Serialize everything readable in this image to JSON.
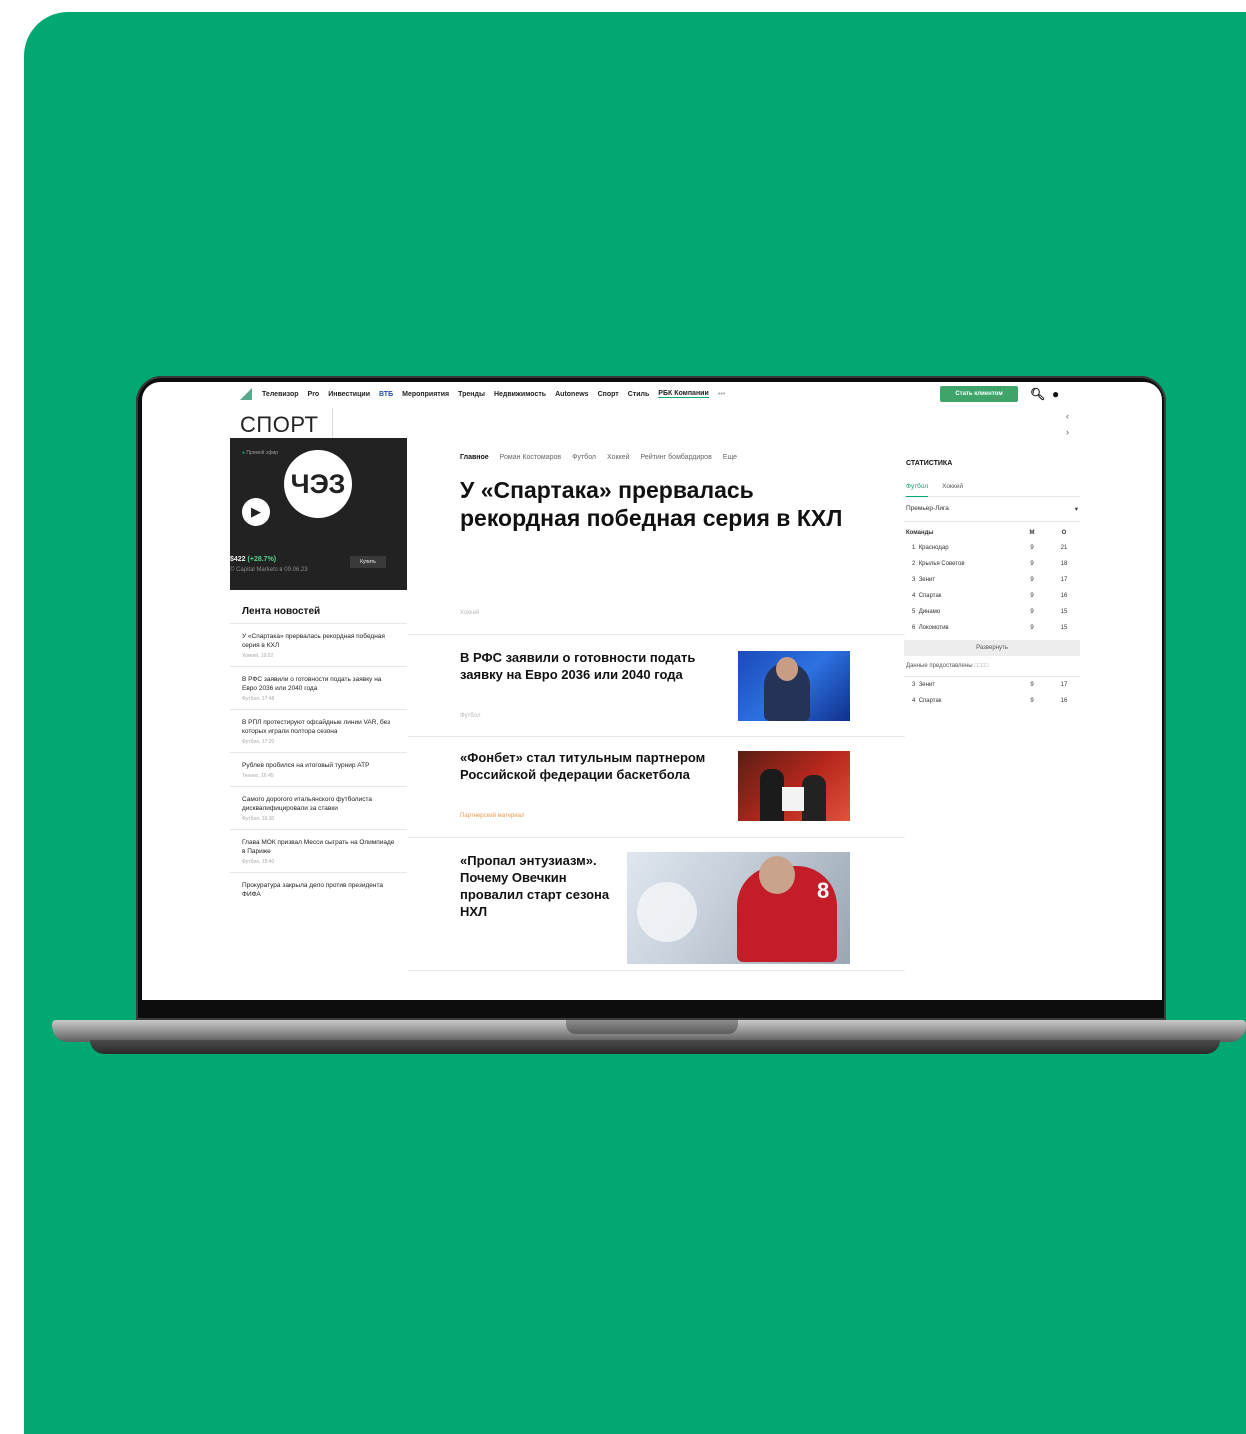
{
  "topnav": {
    "items": [
      "Телевизор",
      "Pro",
      "Инвестиции",
      "ВТБ",
      "Мероприятия",
      "Тренды",
      "Недвижимость",
      "Autonews",
      "Спорт",
      "Стиль",
      "РБК Компании",
      "•••"
    ],
    "cta": "Стать клиентом"
  },
  "section": {
    "title": "СПОРТ"
  },
  "video": {
    "live": "Прямой эфир",
    "brand": "ЧЭЗ",
    "price": "$422",
    "change": "(+28.7%)",
    "source": "© Capital Markets в 09.06.23",
    "buy": "Купить"
  },
  "feed": {
    "title": "Лента новостей",
    "items": [
      {
        "text": "У «Спартака» прервалась рекордная победная серия в КХЛ",
        "meta": "Хоккей, 19:02"
      },
      {
        "text": "В РФС заявили о готовности подать заявку на Евро 2036 или 2040 года",
        "meta": "Футбол, 17:48"
      },
      {
        "text": "В РПЛ протестируют офсайдные линии VAR, без которых играли полтора сезона",
        "meta": "Футбол, 17:20"
      },
      {
        "text": "Рублев пробился на итоговый турнир ATP",
        "meta": "Теннис, 16:45"
      },
      {
        "text": "Самого дорогого итальянского футболиста дисквалифицировали за ставки",
        "meta": "Футбол, 16:30"
      },
      {
        "text": "Глава МОК призвал Месси сыграть на Олимпиаде в Париже",
        "meta": "Футбол, 15:40"
      },
      {
        "text": "Прокуратура закрыла дело против президента ФИФА",
        "meta": ""
      }
    ]
  },
  "crumbs": [
    "Главное",
    "Роман Костомаров",
    "Футбол",
    "Хоккей",
    "Рейтинг бомбардиров",
    "Еще"
  ],
  "headline": {
    "title": "У «Спартака» прервалась рекордная победная серия в КХЛ",
    "rubric": "Хоккей"
  },
  "articles": [
    {
      "title": "В РФС заявили о готовности подать заявку на Евро 2036 или 2040 года",
      "rubric": "Футбол"
    },
    {
      "title": "«Фонбет» стал титульным партнером Российской федерации баскетбола",
      "rubric": "Партнерский материал"
    },
    {
      "title": "«Пропал энтузиазм». Почему Овечкин провалил старт сезона НХЛ",
      "rubric": ""
    }
  ],
  "stats": {
    "title": "СТАТИСТИКА",
    "tabs": [
      "Футбол",
      "Хоккей"
    ],
    "league": "Премьер-Лига",
    "columns": {
      "team": "Команды",
      "m": "М",
      "o": "О"
    },
    "rows": [
      {
        "pos": "1",
        "team": "Краснодар",
        "m": "9",
        "o": "21"
      },
      {
        "pos": "2",
        "team": "Крылья Советов",
        "m": "9",
        "o": "18"
      },
      {
        "pos": "3",
        "team": "Зенит",
        "m": "9",
        "o": "17"
      },
      {
        "pos": "4",
        "team": "Спартак",
        "m": "9",
        "o": "16"
      },
      {
        "pos": "5",
        "team": "Динамо",
        "m": "9",
        "o": "15"
      },
      {
        "pos": "6",
        "team": "Локомотив",
        "m": "9",
        "o": "15"
      }
    ],
    "expand": "Развернуть",
    "provided_label": "Данные предоставлены",
    "provided_by": "□□□□",
    "extra_rows": [
      {
        "pos": "3",
        "team": "Зенит",
        "m": "9",
        "o": "17"
      },
      {
        "pos": "4",
        "team": "Спартак",
        "m": "9",
        "o": "16"
      }
    ]
  },
  "colors": {
    "background": "#01a872",
    "accent": "#01a872",
    "cta": "#3fa46a",
    "partner": "#e89a4e"
  }
}
